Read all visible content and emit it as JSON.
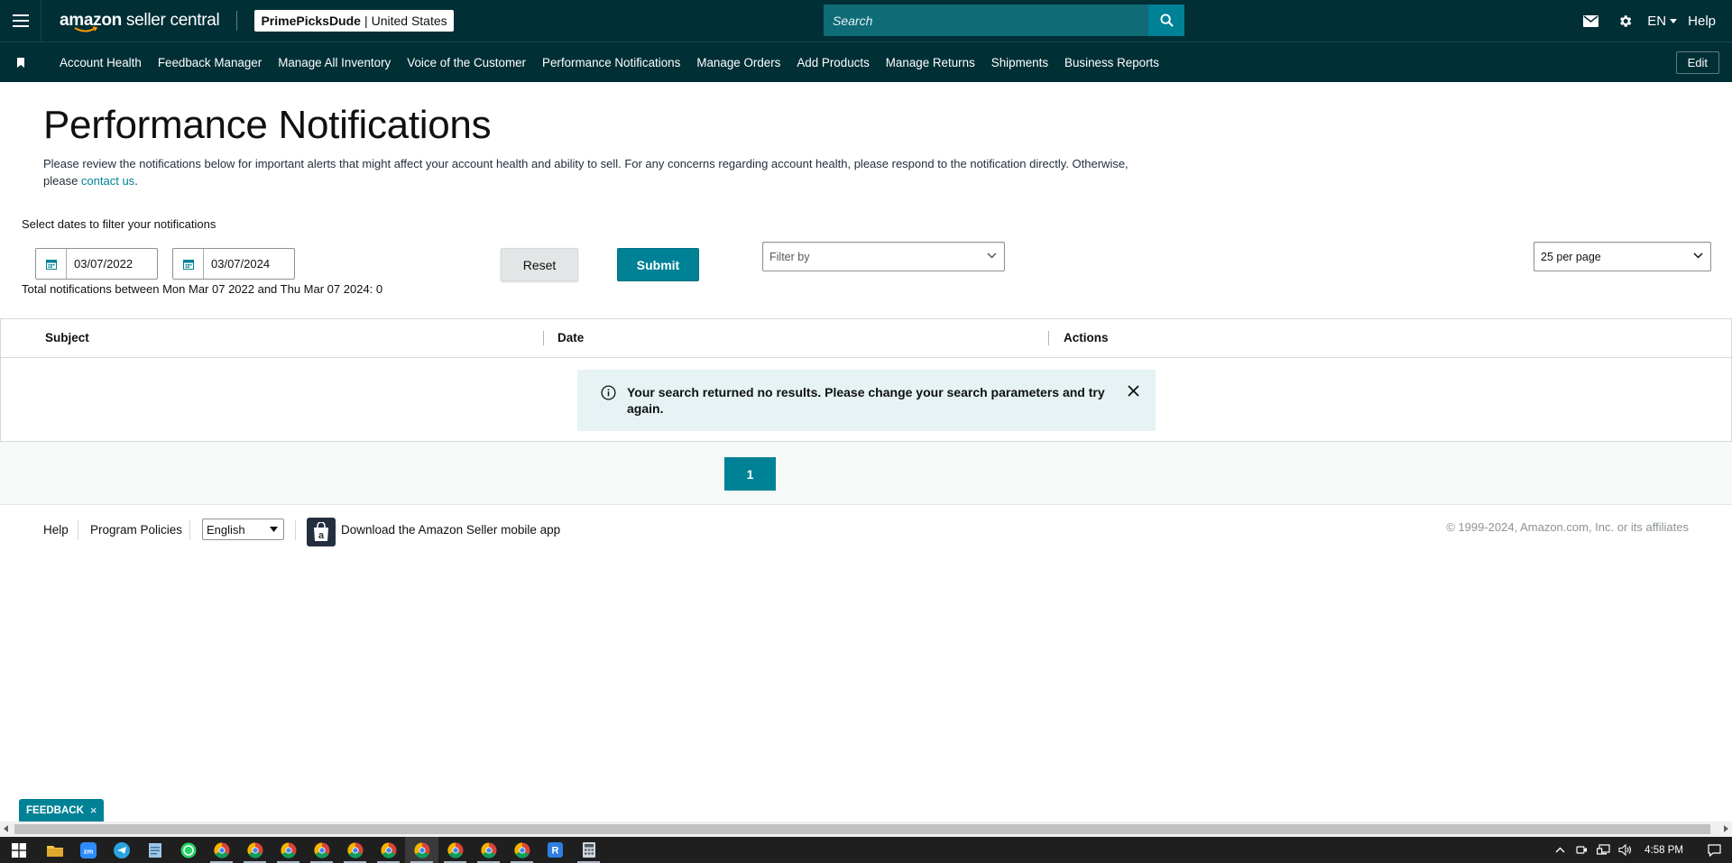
{
  "topbar": {
    "logo_amazon": "amazon",
    "logo_rest": " seller central",
    "store_name": "PrimePicksDude",
    "store_sep": "|",
    "store_region": "United States",
    "search_placeholder": "Search",
    "language": "EN",
    "help": "Help",
    "icons": [
      "menu-icon",
      "mail-icon",
      "gear-icon",
      "search-icon"
    ]
  },
  "nav": {
    "items": [
      "Account Health",
      "Feedback Manager",
      "Manage All Inventory",
      "Voice of the Customer",
      "Performance Notifications",
      "Manage Orders",
      "Add Products",
      "Manage Returns",
      "Shipments",
      "Business Reports"
    ],
    "edit": "Edit"
  },
  "page": {
    "title": "Performance Notifications",
    "intro": "Please review the notifications below for important alerts that might affect your account health and ability to sell. For any concerns regarding account health, please respond to the notification directly. Otherwise, please ",
    "intro_link": "contact us",
    "intro_end": "."
  },
  "filters": {
    "label": "Select dates to filter your notifications",
    "start_date": "03/07/2022",
    "end_date": "03/07/2024",
    "total": "Total notifications between Mon Mar 07 2022 and Thu Mar 07 2024: 0",
    "reset": "Reset",
    "submit": "Submit",
    "filter_by": "Filter by",
    "per_page": "25 per page"
  },
  "table": {
    "headers": [
      "Subject",
      "Date",
      "Actions"
    ],
    "alert": "Your search returned no results. Please change your search parameters and try again."
  },
  "pagination": {
    "current": "1"
  },
  "footer": {
    "help": "Help",
    "policies": "Program Policies",
    "language": "English",
    "app": "Download the Amazon Seller mobile app",
    "copyright": "© 1999-2024, Amazon.com, Inc. or its affiliates"
  },
  "feedback": {
    "label": "FEEDBACK",
    "close": "×"
  },
  "taskbar": {
    "time": "4:58 PM"
  },
  "colors": {
    "header": "#002f36",
    "accent": "#008296",
    "alert_bg": "#e6f2f3"
  }
}
